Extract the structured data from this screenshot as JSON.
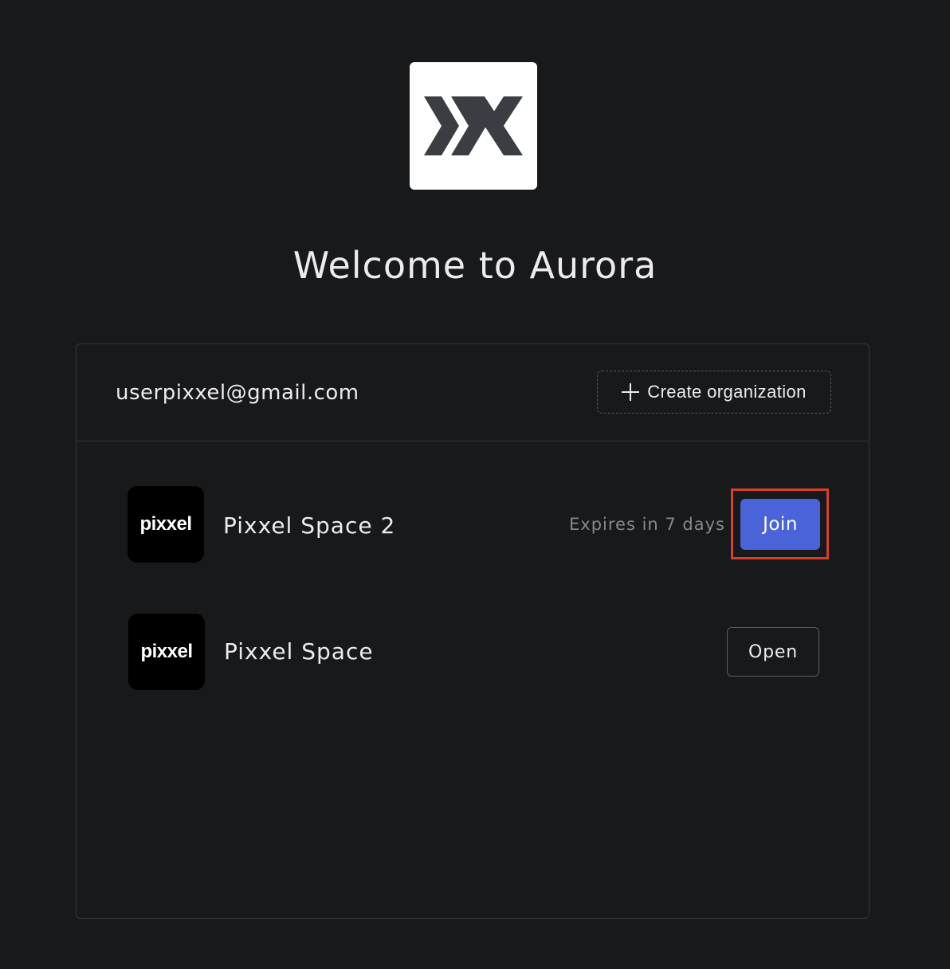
{
  "app": {
    "title": "Welcome to Aurora",
    "logo_icon": "aurora-logo-icon"
  },
  "account": {
    "email": "userpixxel@gmail.com"
  },
  "actions": {
    "create_org_label": "Create organization"
  },
  "organizations": [
    {
      "name": "Pixxel Space 2",
      "avatar_text": "pixxel",
      "status": "Expires in 7 days",
      "action_label": "Join",
      "action_color": "#4a63d9",
      "highlighted": true
    },
    {
      "name": "Pixxel Space",
      "avatar_text": "pixxel",
      "action_label": "Open"
    }
  ],
  "colors": {
    "background": "#18191b",
    "accent": "#4a63d9",
    "highlight": "#d8402c"
  }
}
